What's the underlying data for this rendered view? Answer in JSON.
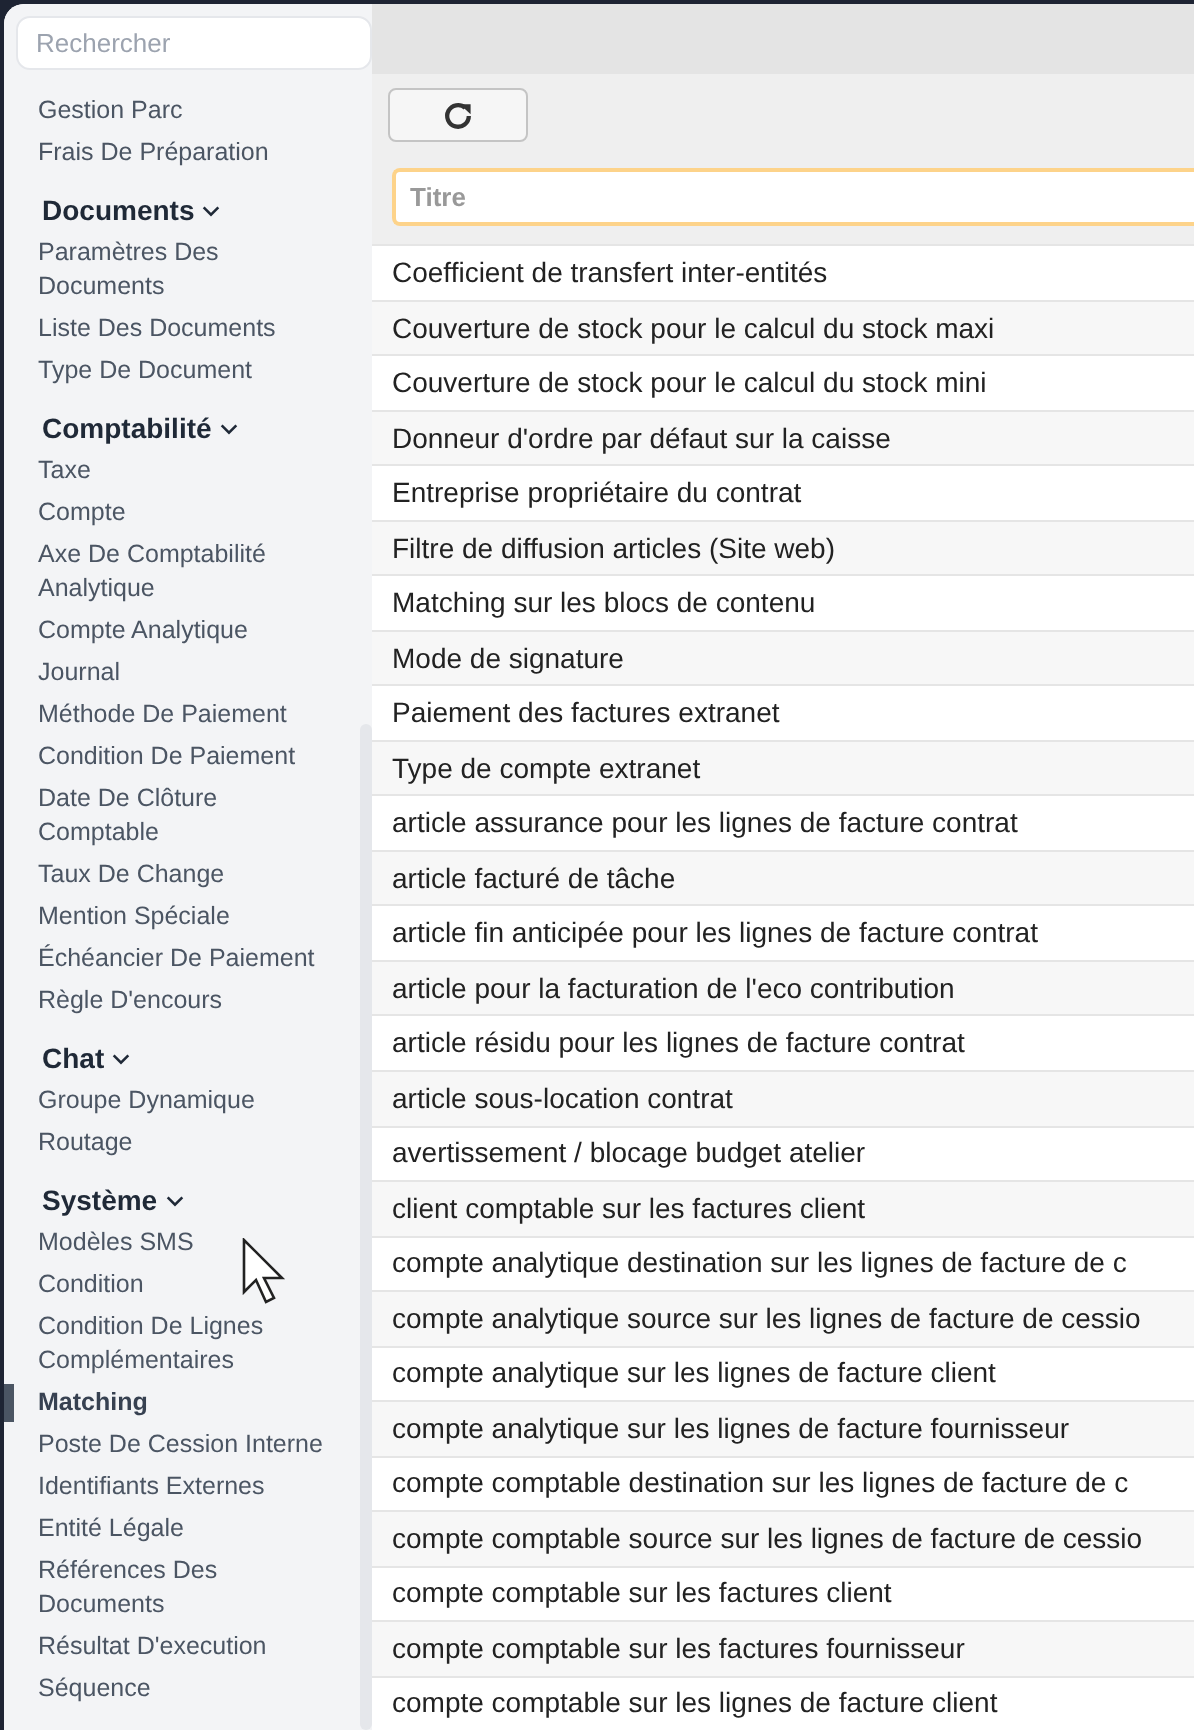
{
  "sidebar": {
    "search": {
      "placeholder": "Rechercher"
    },
    "sections": [
      {
        "items": [
          {
            "label": "Gestion Parc",
            "selected": false
          },
          {
            "label": "Frais De Préparation",
            "selected": false
          }
        ]
      },
      {
        "title": "Documents",
        "expanded": true,
        "items": [
          {
            "label": "Paramètres Des Documents",
            "selected": false
          },
          {
            "label": "Liste Des Documents",
            "selected": false
          },
          {
            "label": "Type De Document",
            "selected": false
          }
        ]
      },
      {
        "title": "Comptabilité",
        "expanded": true,
        "items": [
          {
            "label": "Taxe",
            "selected": false
          },
          {
            "label": "Compte",
            "selected": false
          },
          {
            "label": "Axe De Comptabilité Analytique",
            "selected": false
          },
          {
            "label": "Compte Analytique",
            "selected": false
          },
          {
            "label": "Journal",
            "selected": false
          },
          {
            "label": "Méthode De Paiement",
            "selected": false
          },
          {
            "label": "Condition De Paiement",
            "selected": false
          },
          {
            "label": "Date De Clôture Comptable",
            "selected": false
          },
          {
            "label": "Taux De Change",
            "selected": false
          },
          {
            "label": "Mention Spéciale",
            "selected": false
          },
          {
            "label": "Échéancier De Paiement",
            "selected": false
          },
          {
            "label": "Règle D'encours",
            "selected": false
          }
        ]
      },
      {
        "title": "Chat",
        "expanded": true,
        "items": [
          {
            "label": "Groupe Dynamique",
            "selected": false
          },
          {
            "label": "Routage",
            "selected": false
          }
        ]
      },
      {
        "title": "Système",
        "expanded": true,
        "items": [
          {
            "label": "Modèles SMS",
            "selected": false
          },
          {
            "label": "Condition",
            "selected": false
          },
          {
            "label": "Condition De Lignes Complémentaires",
            "selected": false
          },
          {
            "label": "Matching",
            "selected": true
          },
          {
            "label": "Poste De Cession Interne",
            "selected": false
          },
          {
            "label": "Identifiants Externes",
            "selected": false
          },
          {
            "label": "Entité Légale",
            "selected": false
          },
          {
            "label": "Références Des Documents",
            "selected": false
          },
          {
            "label": "Résultat D'execution",
            "selected": false
          },
          {
            "label": "Séquence",
            "selected": false
          }
        ]
      }
    ]
  },
  "filter": {
    "placeholder": "Titre"
  },
  "rows": [
    "Coefficient de transfert inter-entités",
    "Couverture de stock pour le calcul du stock maxi",
    "Couverture de stock pour le calcul du stock mini",
    "Donneur d'ordre par défaut sur la caisse",
    "Entreprise propriétaire du contrat",
    "Filtre de diffusion articles (Site web)",
    "Matching sur les blocs de contenu",
    "Mode de signature",
    "Paiement des factures extranet",
    "Type de compte extranet",
    "article assurance pour les lignes de facture contrat",
    "article facturé de tâche",
    "article fin anticipée pour les lignes de facture contrat",
    "article pour la facturation de l'eco contribution",
    "article résidu pour les lignes de facture contrat",
    "article sous-location contrat",
    "avertissement / blocage budget atelier",
    "client comptable sur les factures client",
    "compte analytique destination sur les lignes de facture de c",
    "compte analytique source sur les lignes de facture de cessio",
    "compte analytique sur les lignes de facture client",
    "compte analytique sur les lignes de facture fournisseur",
    "compte comptable destination sur les lignes de facture de c",
    "compte comptable source sur les lignes de facture de cessio",
    "compte comptable sur les factures client",
    "compte comptable sur les factures fournisseur",
    "compte comptable sur les lignes de facture client"
  ]
}
